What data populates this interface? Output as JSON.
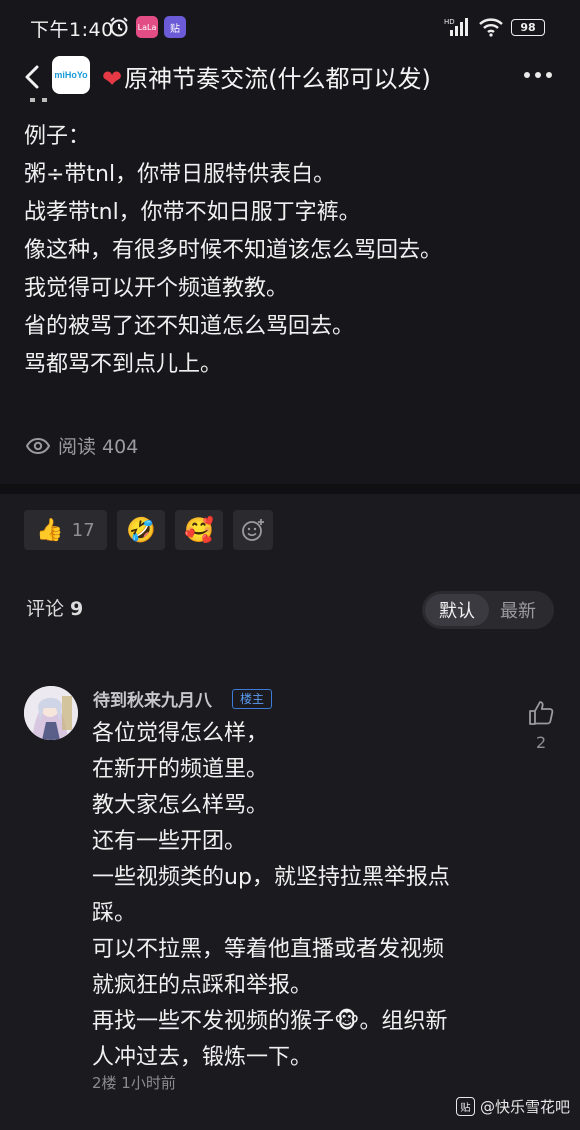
{
  "status_bar": {
    "time": "下午1:40",
    "battery": "98"
  },
  "header": {
    "logo_text": "miHoYo",
    "title": "原神节奏交流(什么都可以发)"
  },
  "post": {
    "lines": [
      "例子：",
      "粥÷带tnl，你带日服特供表白。",
      "战孝带tnl，你带不如日服丁字裤。",
      "像这种，有很多时候不知道该怎么骂回去。",
      "我觉得可以开个频道教教。",
      "省的被骂了还不知道怎么骂回去。",
      "骂都骂不到点儿上。"
    ],
    "views_label": "阅读 404"
  },
  "reactions": {
    "thumbs_count": "17"
  },
  "comments": {
    "label": "评论",
    "count": "9",
    "sort_default": "默认",
    "sort_latest": "最新"
  },
  "comment": {
    "username": "待到秋来九月八",
    "badge": "楼主",
    "like_count": "2",
    "lines": [
      "各位觉得怎么样，",
      "在新开的频道里。",
      "教大家怎么样骂。",
      "还有一些开团。",
      "一些视频类的up，就坚持拉黑举报点",
      "踩。",
      "可以不拉黑，等着他直播或者发视频",
      "就疯狂的点踩和举报。",
      "再找一些不发视频的猴子🐵。组织新",
      "人冲过去，锻炼一下。"
    ],
    "meta": "2楼 1小时前"
  },
  "watermark": {
    "icon_text": "贴",
    "text": "@快乐雪花吧"
  }
}
